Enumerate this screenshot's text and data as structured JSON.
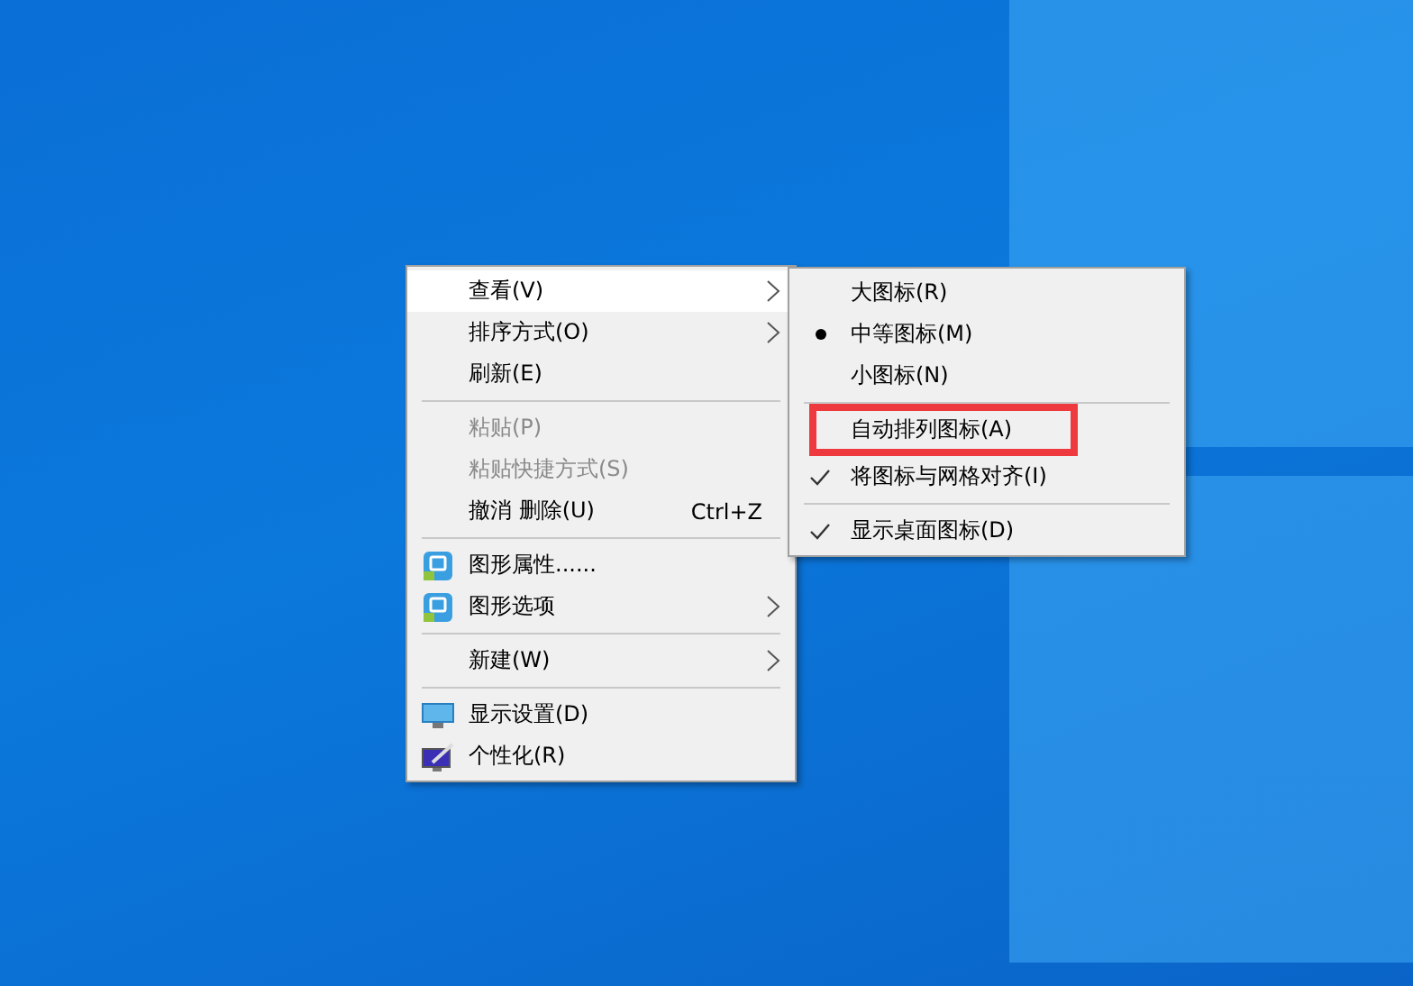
{
  "context_menu": {
    "items": [
      {
        "kind": "plain",
        "label": "查看(V)",
        "highlighted": true,
        "disabled": false,
        "submenu": true
      },
      {
        "kind": "plain",
        "label": "排序方式(O)",
        "highlighted": false,
        "disabled": false,
        "submenu": true
      },
      {
        "kind": "plain",
        "label": "刷新(E)",
        "highlighted": false,
        "disabled": false,
        "submenu": false
      },
      {
        "kind": "separator"
      },
      {
        "kind": "plain",
        "label": "粘贴(P)",
        "highlighted": false,
        "disabled": true,
        "submenu": false
      },
      {
        "kind": "plain",
        "label": "粘贴快捷方式(S)",
        "highlighted": false,
        "disabled": true,
        "submenu": false
      },
      {
        "kind": "plain",
        "label": "撤消 删除(U)",
        "shortcut": "Ctrl+Z",
        "highlighted": false,
        "disabled": false,
        "submenu": false
      },
      {
        "kind": "separator"
      },
      {
        "kind": "graphics",
        "label": "图形属性......",
        "highlighted": false,
        "disabled": false,
        "submenu": false
      },
      {
        "kind": "graphics",
        "label": "图形选项",
        "highlighted": false,
        "disabled": false,
        "submenu": true
      },
      {
        "kind": "separator"
      },
      {
        "kind": "plain",
        "label": "新建(W)",
        "highlighted": false,
        "disabled": false,
        "submenu": true
      },
      {
        "kind": "separator"
      },
      {
        "kind": "display",
        "label": "显示设置(D)",
        "highlighted": false,
        "disabled": false,
        "submenu": false
      },
      {
        "kind": "personalize",
        "label": "个性化(R)",
        "highlighted": false,
        "disabled": false,
        "submenu": false
      }
    ]
  },
  "view_submenu": {
    "items": [
      {
        "kind": "radio",
        "label": "大图标(R)",
        "selected": false,
        "annotated": false
      },
      {
        "kind": "radio",
        "label": "中等图标(M)",
        "selected": true,
        "annotated": false
      },
      {
        "kind": "radio",
        "label": "小图标(N)",
        "selected": false,
        "annotated": false
      },
      {
        "kind": "separator"
      },
      {
        "kind": "check",
        "label": "自动排列图标(A)",
        "checked": false,
        "annotated": true
      },
      {
        "kind": "check",
        "label": "将图标与网格对齐(I)",
        "checked": true,
        "annotated": false
      },
      {
        "kind": "separator"
      },
      {
        "kind": "check",
        "label": "显示桌面图标(D)",
        "checked": true,
        "annotated": false
      }
    ]
  }
}
